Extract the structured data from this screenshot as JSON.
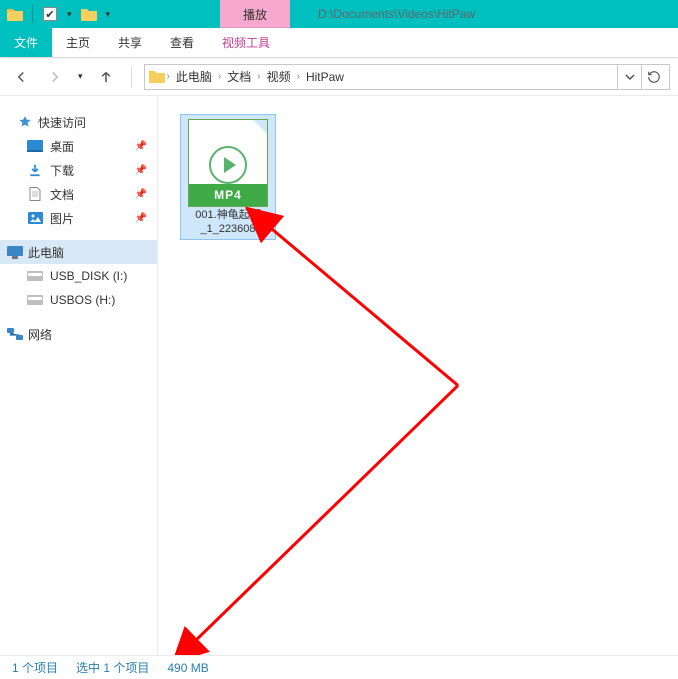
{
  "titlebar": {
    "context_tab": "播放",
    "address_text": "D:\\Documents\\Videos\\HitPaw"
  },
  "ribbon": {
    "file_tab": "文件",
    "tabs": [
      "主页",
      "共享",
      "查看"
    ],
    "context_tab": "视频工具"
  },
  "breadcrumb": {
    "items": [
      "此电脑",
      "文档",
      "视频",
      "HitPaw"
    ]
  },
  "navpane": {
    "quick_access": {
      "label": "快速访问"
    },
    "quick_items": [
      {
        "label": "桌面",
        "pinned": true,
        "icon": "desktop"
      },
      {
        "label": "下载",
        "pinned": true,
        "icon": "download"
      },
      {
        "label": "文档",
        "pinned": true,
        "icon": "document"
      },
      {
        "label": "图片",
        "pinned": true,
        "icon": "picture"
      }
    ],
    "this_pc": "此电脑",
    "drives": [
      {
        "label": "USB_DISK (I:)"
      },
      {
        "label": "USBOS (H:)"
      }
    ],
    "network": "网络"
  },
  "files": [
    {
      "name_line1": "001.神龟起源",
      "name_line2": "_1_223608",
      "format_badge": "MP4"
    }
  ],
  "status": {
    "item_count": "1 个项目",
    "selection": "选中 1 个项目",
    "size": "490 MB"
  },
  "colors": {
    "accent": "#00bfbf",
    "context_pink": "#f7a8ce",
    "annotation_red": "#ff0000",
    "selection_blue": "#cfe7fb"
  }
}
